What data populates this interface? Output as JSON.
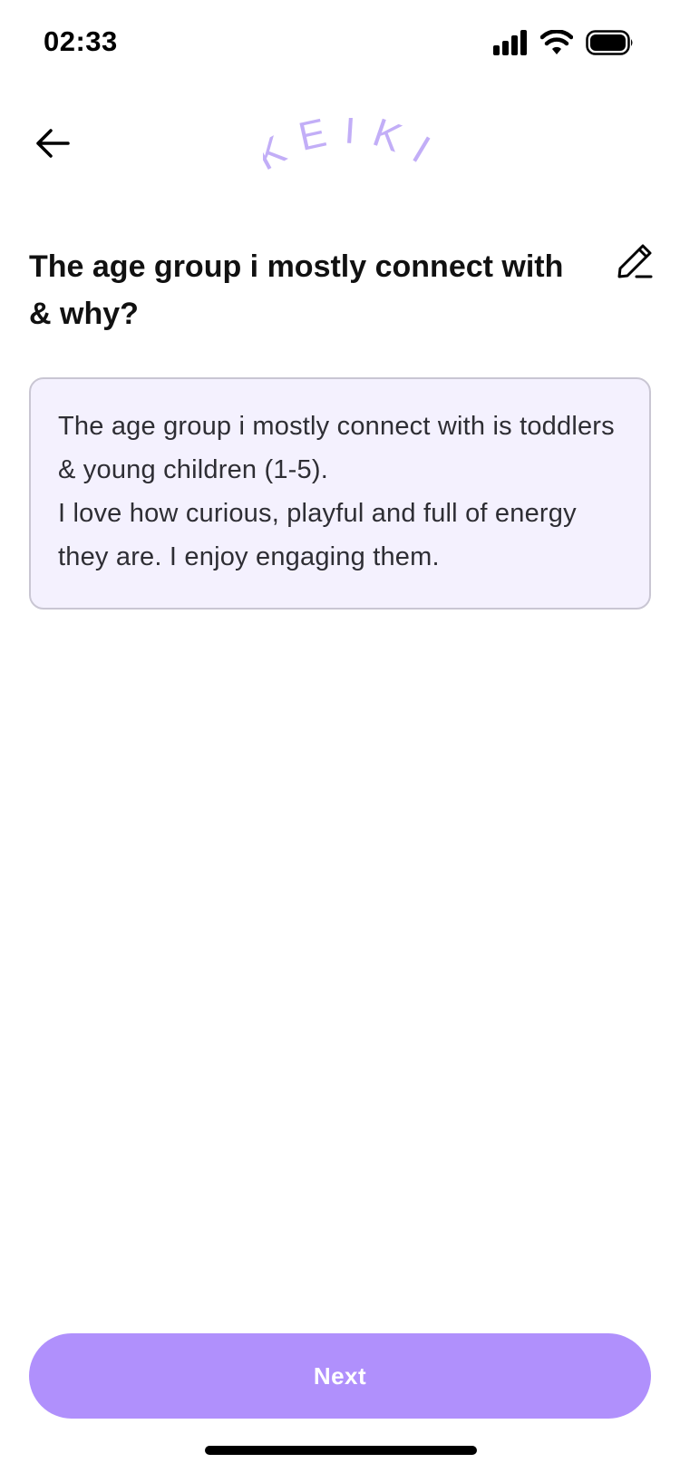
{
  "status_bar": {
    "time": "02:33",
    "icons": [
      "cellular-signal-icon",
      "wifi-icon",
      "battery-icon"
    ]
  },
  "header": {
    "back_icon": "arrow-left-icon",
    "logo_text": "KEIKI",
    "logo_color": "#c2aef7"
  },
  "question": {
    "title": "The age group i mostly connect with & why?",
    "edit_icon": "pencil-icon"
  },
  "answer": {
    "text": "The age group i mostly connect with is toddlers & young children (1-5).\nI love how curious, playful and full of energy they are. I enjoy engaging them."
  },
  "footer": {
    "next_label": "Next"
  },
  "colors": {
    "accent": "#b090fc",
    "answer_background": "#f4f1fe",
    "answer_border": "#c9c6d3"
  }
}
